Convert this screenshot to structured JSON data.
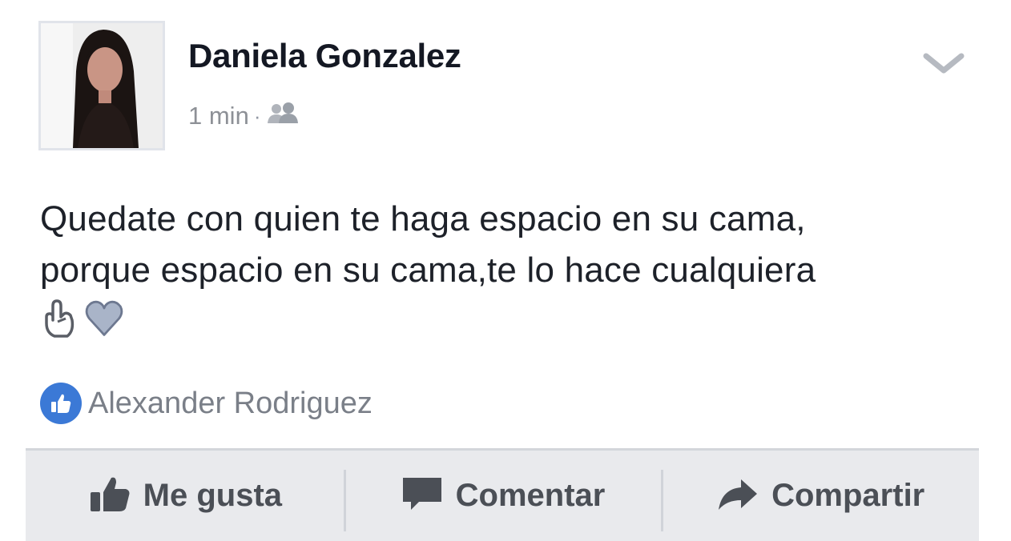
{
  "post": {
    "author_name": "Daniela Gonzalez",
    "timestamp": "1 min",
    "separator": "·",
    "privacy_icon": "friends-icon",
    "menu_icon": "chevron-down-icon",
    "text_line_1": "Quedate con quien te haga espacio en su cama,",
    "text_line_2": "porque espacio en su cama,te lo hace cualquiera",
    "emoji_icons": [
      "hand-gesture-icon",
      "heart-icon"
    ]
  },
  "likes": {
    "icon": "like-badge-icon",
    "liker_name": "Alexander Rodriguez"
  },
  "actions": {
    "like_label": "Me gusta",
    "comment_label": "Comentar",
    "share_label": "Compartir"
  },
  "colors": {
    "accent_blue": "#3b79d6",
    "action_bar_bg": "#e9eaed",
    "name_text": "#141823",
    "muted_text": "#8d9096"
  }
}
